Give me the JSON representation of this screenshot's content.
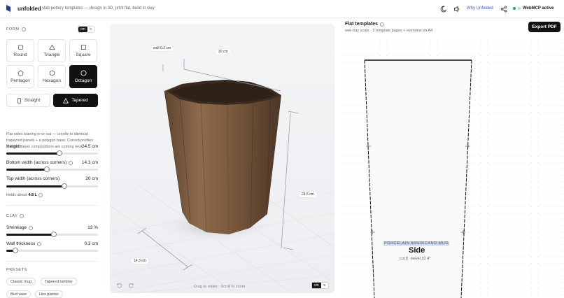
{
  "header": {
    "brand": "unfolded",
    "tagline": "slab pottery templates — design in 3D, print flat, build in clay",
    "why_link": "Why Unfolded",
    "mcp_status": "WebMCP active"
  },
  "form": {
    "label": "FORM",
    "unit_options": [
      "cm",
      "in"
    ],
    "unit_selected": "cm",
    "shapes": [
      {
        "label": "Round",
        "icon": "circle-icon"
      },
      {
        "label": "Triangle",
        "icon": "triangle-icon"
      },
      {
        "label": "Square",
        "icon": "square-icon"
      },
      {
        "label": "Pentagon",
        "icon": "pentagon-icon"
      },
      {
        "label": "Hexagon",
        "icon": "hexagon-icon"
      },
      {
        "label": "Octagon",
        "icon": "octagon-icon",
        "selected": true
      }
    ],
    "profiles": [
      {
        "label": "Straight",
        "icon": "rectangle-icon"
      },
      {
        "label": "Tapered",
        "icon": "triangle-icon",
        "selected": true
      }
    ],
    "description": "Flat sides leaning in or out — unrolls to identical trapezoid panels + a polygon base. Curved profiles and multilayer compositions are coming next.",
    "sliders": {
      "height": {
        "label": "Height",
        "value": "24.5 cm",
        "fraction": 0.58
      },
      "bottom": {
        "label": "Bottom width (across corners)",
        "value": "14.3 cm",
        "fraction": 0.44
      },
      "top": {
        "label": "Top width (across corners)",
        "value": "20 cm",
        "fraction": 0.63
      }
    },
    "holds_prefix": "Holds about",
    "holds_value": "4.8 L"
  },
  "clay": {
    "label": "CLAY",
    "sliders": {
      "shrinkage": {
        "label": "Shrinkage",
        "value": "13 %",
        "fraction": 0.52
      },
      "wall": {
        "label": "Wall thickness",
        "value": "0.3 cm",
        "fraction": 0.1
      }
    }
  },
  "presets": {
    "label": "PRESETS",
    "items": [
      "Classic mug",
      "Tapered tumbler",
      "Bud vase",
      "Hex planter"
    ]
  },
  "viewer": {
    "dim_wall": "wall 0.3 cm",
    "dim_top": "20 cm",
    "dim_height": "24.5 cm",
    "dim_bottom": "14.3 cm",
    "hint": "Drag to rotate · Scroll to zoom",
    "unit_options": [
      "cm",
      "in"
    ],
    "colors": {
      "clay_light": "#8a6a4a",
      "clay_dark": "#5a4030"
    }
  },
  "templates": {
    "title": "Flat templates",
    "subtitle": "wet-clay scale · 2 template pages + overview on A4",
    "export_label": "Export PDF",
    "panel_material": "PORCELAIN AMERICANO MUG",
    "panel_name": "Side",
    "panel_detail": "cut 8 · bevel 22.4°"
  }
}
